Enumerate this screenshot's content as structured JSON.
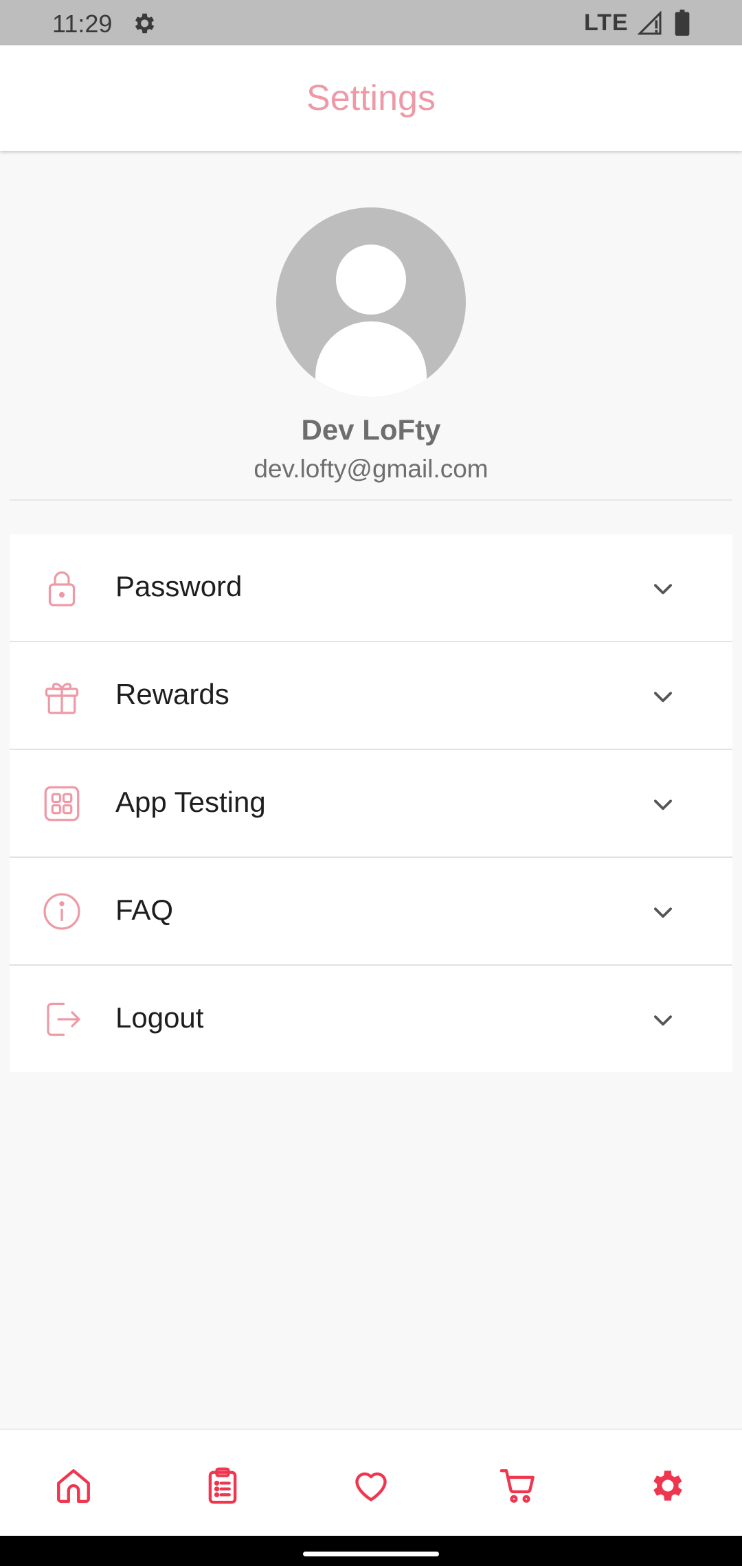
{
  "status_bar": {
    "time": "11:29",
    "network": "LTE",
    "icons": [
      "settings-gear-icon",
      "signal-icon",
      "battery-icon"
    ]
  },
  "header": {
    "title": "Settings"
  },
  "profile": {
    "name": "Dev LoFty",
    "email": "dev.lofty@gmail.com",
    "avatar_icon": "default-avatar-icon"
  },
  "menu": {
    "items": [
      {
        "label": "Password",
        "icon": "lock-icon"
      },
      {
        "label": "Rewards",
        "icon": "gift-icon"
      },
      {
        "label": "App Testing",
        "icon": "grid-icon"
      },
      {
        "label": "FAQ",
        "icon": "info-icon"
      },
      {
        "label": "Logout",
        "icon": "logout-icon"
      }
    ]
  },
  "bottom_nav": {
    "items": [
      {
        "name": "home",
        "icon": "home-icon",
        "active": false
      },
      {
        "name": "orders",
        "icon": "clipboard-list-icon",
        "active": false
      },
      {
        "name": "favorites",
        "icon": "heart-icon",
        "active": false
      },
      {
        "name": "cart",
        "icon": "cart-icon",
        "active": false
      },
      {
        "name": "settings",
        "icon": "gear-icon",
        "active": true
      }
    ]
  },
  "colors": {
    "accent_soft": "#ee9aa6",
    "accent": "#f0364e",
    "status_bar": "#bdbdbd",
    "background": "#f8f8f8"
  }
}
